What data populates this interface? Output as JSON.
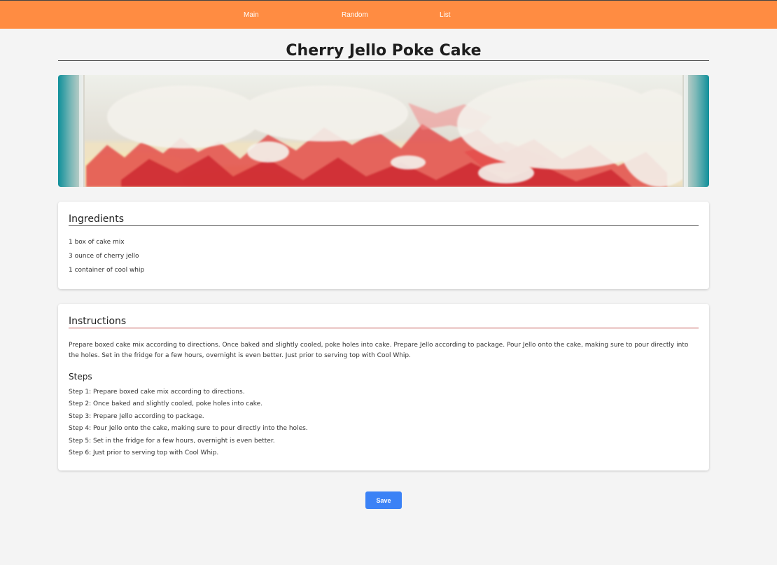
{
  "nav": {
    "items": [
      {
        "label": "Main"
      },
      {
        "label": "Random"
      },
      {
        "label": "List"
      }
    ]
  },
  "recipe": {
    "title": "Cherry Jello Poke Cake",
    "image_alt": "cherry jello poke cake photo"
  },
  "ingredients": {
    "heading": "Ingredients",
    "items": [
      "1 box of cake mix",
      "3 ounce of cherry jello",
      "1 container of cool whip"
    ]
  },
  "instructions": {
    "heading": "Instructions",
    "text": "Prepare boxed cake mix according to directions. Once baked and slightly cooled, poke holes into cake. Prepare Jello according to package. Pour Jello onto the cake, making sure to pour directly into the holes. Set in the fridge for a few hours, overnight is even better. Just prior to serving top with Cool Whip.",
    "steps_heading": "Steps",
    "steps": [
      "Step 1: Prepare boxed cake mix according to directions.",
      "Step 2: Once baked and slightly cooled, poke holes into cake.",
      "Step 3: Prepare Jello according to package.",
      "Step 4: Pour Jello onto the cake, making sure to pour directly into the holes.",
      "Step 5: Set in the fridge for a few hours, overnight is even better.",
      "Step 6: Just prior to serving top with Cool Whip."
    ]
  },
  "actions": {
    "save_label": "Save"
  },
  "colors": {
    "topbar": "#ff8c42",
    "save_button": "#3b82f6",
    "instructions_rule": "#c0504d",
    "ingredients_rule": "#555555",
    "page_background": "#f4f4f4"
  }
}
